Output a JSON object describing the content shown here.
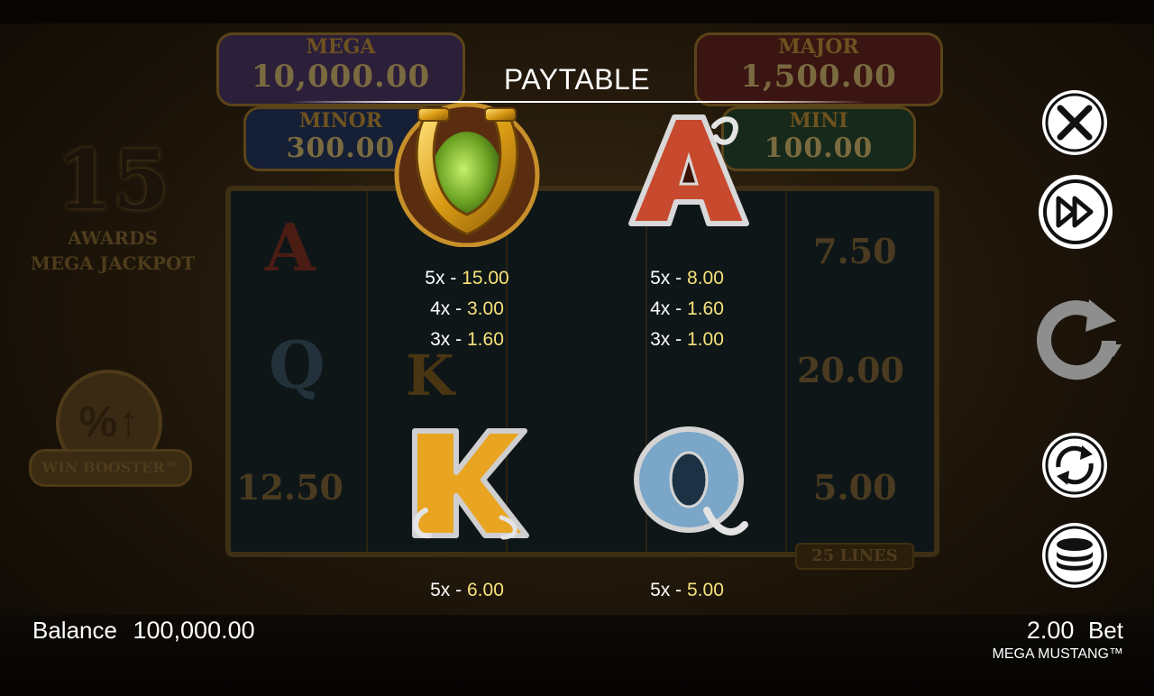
{
  "background": {
    "jackpots": [
      {
        "name": "MEGA",
        "value": "10,000.00"
      },
      {
        "name": "MAJOR",
        "value": "1,500.00"
      },
      {
        "name": "MINOR",
        "value": "300.00"
      },
      {
        "name": "MINI",
        "value": "100.00"
      }
    ],
    "feature_count": "15",
    "feature_text_1": "AWARDS",
    "feature_text_2": "MEGA JACKPOT",
    "win_booster": "WIN BOOSTER™",
    "lines": "25 LINES",
    "reel_values": [
      "7.50",
      "20.00",
      "5.00",
      "12.50"
    ]
  },
  "paytable": {
    "title": "PAYTABLE",
    "symbols": [
      {
        "icon": "horseshoe-icon",
        "pays": [
          {
            "mult": "5x",
            "value": "15.00"
          },
          {
            "mult": "4x",
            "value": "3.00"
          },
          {
            "mult": "3x",
            "value": "1.60"
          }
        ]
      },
      {
        "icon": "letter-a-icon",
        "letter": "A",
        "pays": [
          {
            "mult": "5x",
            "value": "8.00"
          },
          {
            "mult": "4x",
            "value": "1.60"
          },
          {
            "mult": "3x",
            "value": "1.00"
          }
        ]
      },
      {
        "icon": "letter-k-icon",
        "letter": "K",
        "pays": [
          {
            "mult": "5x",
            "value": "6.00"
          }
        ]
      },
      {
        "icon": "letter-q-icon",
        "letter": "Q",
        "pays": [
          {
            "mult": "5x",
            "value": "5.00"
          }
        ]
      }
    ],
    "separator": "-"
  },
  "controls": {
    "close_icon": "close-icon",
    "turbo_icon": "fast-forward-icon",
    "spin_icon": "spin-icon",
    "autoplay_icon": "autoplay-icon",
    "bet_icon": "coin-stack-icon"
  },
  "footer": {
    "balance_label": "Balance",
    "balance_value": "100,000.00",
    "bet_value": "2.00",
    "bet_label": "Bet",
    "game_name": "MEGA MUSTANG™"
  },
  "colors": {
    "pay_value": "#f7e27a",
    "text": "#ffffff",
    "gold": "#d9a21c"
  }
}
